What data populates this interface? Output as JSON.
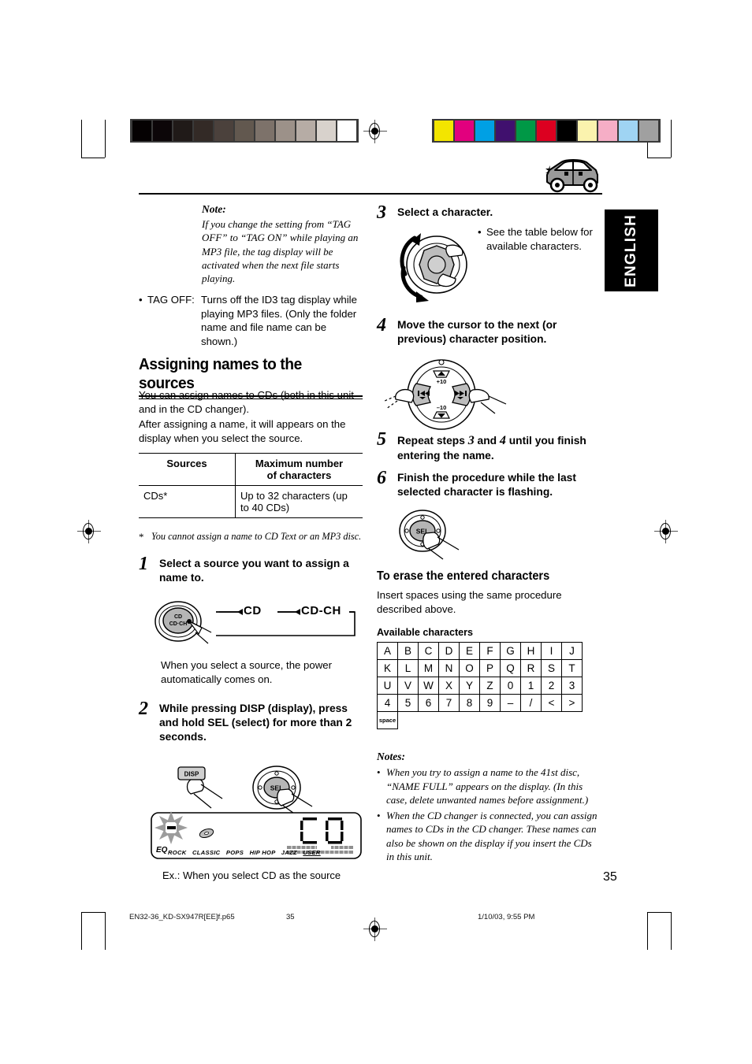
{
  "page": {
    "number": "35",
    "language_tab": "ENGLISH"
  },
  "footer": {
    "filename": "EN32-36_KD-SX947R[EE]f.p65",
    "page": "35",
    "timestamp": "1/10/03, 9:55 PM"
  },
  "left_column": {
    "note": {
      "heading": "Note:",
      "body": "If you change the setting from “TAG OFF” to “TAG ON” while playing an MP3 file, the tag display will be activated when the next file starts playing."
    },
    "tag_off": {
      "bullet": "•",
      "label": "TAG OFF:",
      "text": "Turns off the ID3 tag display while playing MP3 files. (Only the folder name and file name can be shown.)"
    },
    "section_title": "Assigning names to the sources",
    "intro_1": "You can assign names to CDs (both in this unit and in the CD changer).",
    "intro_2": "After assigning a name, it will appears on the display when you select the source.",
    "table": {
      "headers": [
        "Sources",
        "Maximum number\nof characters"
      ],
      "header_col1": "Sources",
      "header_col2_line1": "Maximum number",
      "header_col2_line2": "of characters",
      "rows": [
        {
          "source": "CDs*",
          "max": "Up to 32 characters (up to 40 CDs)"
        }
      ]
    },
    "footnote_marker": "*",
    "footnote": "You cannot assign a name to CD Text or an MP3 disc.",
    "steps": [
      {
        "number": "1",
        "text": "Select a source you want to assign a name to.",
        "diagram": {
          "button_line1": "CD",
          "button_line2": "CD-CH",
          "flow": [
            "CD",
            "CD-CH"
          ]
        },
        "after_text": "When you select a source, the power automatically comes on."
      },
      {
        "number": "2",
        "text": "While pressing DISP (display), press and hold SEL (select) for more than 2 seconds.",
        "diagram": {
          "disp_button": "DISP",
          "sel_button": "SEL",
          "display_readout": "CD",
          "eq_label": "EQ",
          "eq_modes": [
            "ROCK",
            "CLASSIC",
            "POPS",
            "HIP HOP",
            "JAZZ",
            "USER"
          ]
        },
        "caption": "Ex.: When you select CD as the source"
      }
    ]
  },
  "right_column": {
    "steps": [
      {
        "number": "3",
        "text": "Select a character.",
        "side_bullet": "•",
        "side_note": "See the table below for available characters."
      },
      {
        "number": "4",
        "text": "Move the cursor to the next (or previous) character position.",
        "diagram": {
          "plus10": "+10",
          "minus10": "–10",
          "prev": "❘◀◀",
          "next": "▶▶❘"
        }
      },
      {
        "number": "5",
        "text_parts": [
          "Repeat steps ",
          "3",
          " and ",
          "4",
          " until you finish entering the name."
        ],
        "text": "Repeat steps 3 and 4 until you finish entering the name."
      },
      {
        "number": "6",
        "text": "Finish the procedure while the last selected character is flashing.",
        "diagram": {
          "sel_button": "SEL"
        }
      }
    ],
    "erase": {
      "heading": "To erase the entered characters",
      "body": "Insert spaces using the same procedure described above."
    },
    "available_characters": {
      "heading": "Available characters",
      "rows": [
        [
          "A",
          "B",
          "C",
          "D",
          "E",
          "F",
          "G",
          "H",
          "I",
          "J"
        ],
        [
          "K",
          "L",
          "M",
          "N",
          "O",
          "P",
          "Q",
          "R",
          "S",
          "T"
        ],
        [
          "U",
          "V",
          "W",
          "X",
          "Y",
          "Z",
          "0",
          "1",
          "2",
          "3"
        ],
        [
          "4",
          "5",
          "6",
          "7",
          "8",
          "9",
          "–",
          "/",
          "<",
          ">"
        ],
        [
          "space"
        ]
      ]
    },
    "notes": {
      "heading": "Notes:",
      "items": [
        "When you try to assign a name to the 41st disc, “NAME FULL” appears on the display. (In this case, delete unwanted names before assignment.)",
        "When the CD changer is connected, you can assign names to CDs in the CD changer. These names can also be shown on the display if you insert the CDs in this unit."
      ]
    }
  },
  "print_marks": {
    "grayscale_bar": [
      "#050102",
      "#0c0608",
      "#201a18",
      "#332a26",
      "#4b413c",
      "#62584f",
      "#7d726a",
      "#9c9189",
      "#b6aca5",
      "#d8d2cc",
      "#ffffff"
    ],
    "color_bar": [
      "#f3e500",
      "#e2007e",
      "#00a0e4",
      "#40106e",
      "#009846",
      "#dc0020",
      "#000000",
      "#fbf3ae",
      "#f6aec6",
      "#9fd4f3",
      "#a0a0a0"
    ],
    "registration": "registration-target"
  }
}
